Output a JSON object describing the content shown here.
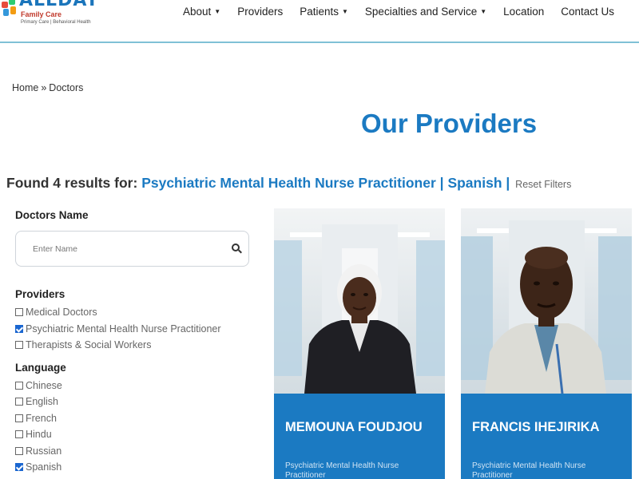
{
  "header": {
    "logo": {
      "brand": "ALLDAY",
      "subtitle": "Family Care",
      "tagline": "Primary Care | Behavioral Health"
    },
    "nav": [
      {
        "label": "About",
        "has_dropdown": true
      },
      {
        "label": "Providers",
        "has_dropdown": false
      },
      {
        "label": "Patients",
        "has_dropdown": true
      },
      {
        "label": "Specialties and Service",
        "has_dropdown": true
      },
      {
        "label": "Location",
        "has_dropdown": false
      },
      {
        "label": "Contact Us",
        "has_dropdown": false
      }
    ]
  },
  "breadcrumb": {
    "home": "Home",
    "separator": "»",
    "current": "Doctors"
  },
  "page_title": "Our Providers",
  "results": {
    "prefix": "Found 4 results for:",
    "query_1": "Psychiatric Mental Health Nurse Practitioner",
    "separator": "|",
    "query_2": "Spanish",
    "reset_label": "Reset Filters"
  },
  "filters": {
    "name_heading": "Doctors Name",
    "name_placeholder": "Enter Name",
    "providers": {
      "title": "Providers",
      "options": [
        {
          "label": "Medical Doctors",
          "checked": false
        },
        {
          "label": "Psychiatric Mental Health Nurse Practitioner",
          "checked": true
        },
        {
          "label": "Therapists & Social Workers",
          "checked": false
        }
      ]
    },
    "language": {
      "title": "Language",
      "options": [
        {
          "label": "Chinese",
          "checked": false
        },
        {
          "label": "English",
          "checked": false
        },
        {
          "label": "French",
          "checked": false
        },
        {
          "label": "Hindu",
          "checked": false
        },
        {
          "label": "Russian",
          "checked": false
        },
        {
          "label": "Spanish",
          "checked": true
        }
      ]
    }
  },
  "providers": [
    {
      "name": "MEMOUNA FOUDJOU",
      "role": "Psychiatric Mental Health Nurse Practitioner"
    },
    {
      "name": "FRANCIS IHEJIRIKA",
      "role": "Psychiatric Mental Health Nurse Practitioner"
    }
  ],
  "colors": {
    "accent": "#1b7ac2",
    "card_bg": "#1b7ac2",
    "checkbox": "#1a66d0"
  }
}
